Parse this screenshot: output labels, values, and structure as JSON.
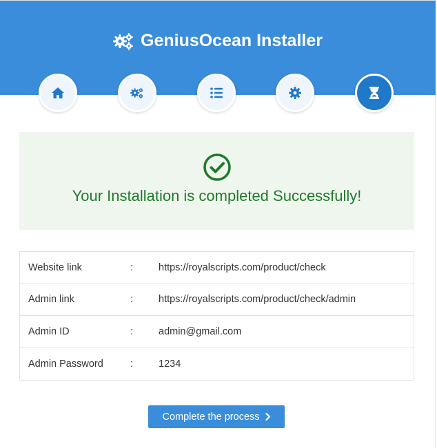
{
  "header": {
    "title": "GeniusOcean Installer",
    "icon": "gears-icon",
    "color": "#3a8ddb"
  },
  "steps": [
    {
      "icon": "home-icon",
      "active": false
    },
    {
      "icon": "gears-icon",
      "active": false
    },
    {
      "icon": "list-icon",
      "active": false
    },
    {
      "icon": "gear-icon",
      "active": false
    },
    {
      "icon": "hourglass-icon",
      "active": true
    }
  ],
  "success": {
    "message": "Your Installation is completed Successfully!",
    "icon": "check-circle-icon",
    "color": "#1f7a2a"
  },
  "info": [
    {
      "label": "Website link",
      "sep": ":",
      "value": "https://royalscripts.com/product/check"
    },
    {
      "label": "Admin link",
      "sep": ":",
      "value": "https://royalscripts.com/product/check/admin"
    },
    {
      "label": "Admin ID",
      "sep": ":",
      "value": "admin@gmail.com"
    },
    {
      "label": "Admin Password",
      "sep": ":",
      "value": "1234"
    }
  ],
  "actions": {
    "complete_label": "Complete the process",
    "complete_icon": "chevron-right-icon"
  }
}
